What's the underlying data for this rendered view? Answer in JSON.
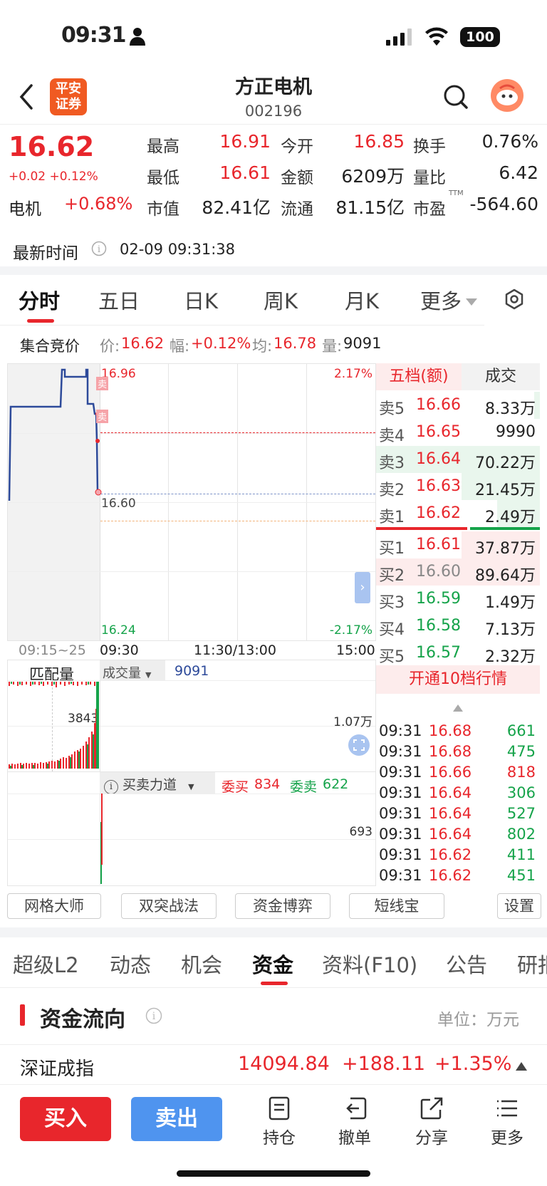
{
  "status": {
    "time": "09:31",
    "battery": "100"
  },
  "header": {
    "broker_logo": "平安\n证券",
    "broker_line1": "平安",
    "broker_line2": "证券",
    "title": "方正电机",
    "code": "002196"
  },
  "quote": {
    "price": "16.62",
    "change": "+0.02 +0.12%",
    "sector_label": "电机",
    "sector_change": "+0.68%",
    "fields": [
      {
        "label": "最高",
        "value": "16.91",
        "color": "red"
      },
      {
        "label": "今开",
        "value": "16.85",
        "color": "red"
      },
      {
        "label": "换手",
        "value": "0.76%",
        "color": "black"
      },
      {
        "label": "最低",
        "value": "16.61",
        "color": "red"
      },
      {
        "label": "金额",
        "value": "6209万",
        "color": "black"
      },
      {
        "label": "量比",
        "value": "6.42",
        "color": "black"
      },
      {
        "label": "市值",
        "value": "82.41亿",
        "color": "black"
      },
      {
        "label": "流通",
        "value": "81.15亿",
        "color": "black"
      },
      {
        "label": "市盈",
        "value": "-564.60",
        "color": "black",
        "sup": "TTM"
      }
    ],
    "latest_time_label": "最新时间",
    "latest_time": "02-09 09:31:38"
  },
  "chart_tabs": [
    "分时",
    "五日",
    "日K",
    "周K",
    "月K",
    "更多"
  ],
  "auction_bar": {
    "label": "集合竞价",
    "price_label": "价:",
    "price": "16.62",
    "range_label": "幅:",
    "range": "+0.12%",
    "avg_label": "均:",
    "avg": "16.78",
    "vol_label": "量:",
    "vol": "9091"
  },
  "chart": {
    "y_top": "16.96",
    "y_mid": "16.60",
    "y_bottom": "16.24",
    "pct_top": "2.17%",
    "pct_bottom": "-2.17%",
    "x_labels": [
      "09:15~25",
      "09:30",
      "11:30/13:00",
      "15:00"
    ],
    "sell_marker": "卖",
    "match_label": "匹配量",
    "volume_label": "成交量",
    "volume_value": "9091",
    "match_value": "3843",
    "volume_right": "1.07万",
    "force_label": "买卖力道",
    "bid_label": "委买",
    "bid_value": "834",
    "ask_label": "委卖",
    "ask_value": "622",
    "force_right": "693"
  },
  "orderbook": {
    "tab_active": "五档(额)",
    "tab_other": "成交",
    "asks": [
      {
        "label": "卖5",
        "price": "16.66",
        "amount": "8.33万"
      },
      {
        "label": "卖4",
        "price": "16.65",
        "amount": "9990"
      },
      {
        "label": "卖3",
        "price": "16.64",
        "amount": "70.22万"
      },
      {
        "label": "卖2",
        "price": "16.63",
        "amount": "21.45万"
      },
      {
        "label": "卖1",
        "price": "16.62",
        "amount": "2.49万"
      }
    ],
    "bids": [
      {
        "label": "买1",
        "price": "16.61",
        "amount": "37.87万"
      },
      {
        "label": "买2",
        "price": "16.60",
        "amount": "89.64万"
      },
      {
        "label": "买3",
        "price": "16.59",
        "amount": "1.49万"
      },
      {
        "label": "买4",
        "price": "16.58",
        "amount": "7.13万"
      },
      {
        "label": "买5",
        "price": "16.57",
        "amount": "2.32万"
      }
    ],
    "open_level10": "开通10档行情"
  },
  "ticks": [
    {
      "time": "09:31",
      "price": "16.68",
      "vol": "661"
    },
    {
      "time": "09:31",
      "price": "16.68",
      "vol": "475"
    },
    {
      "time": "09:31",
      "price": "16.66",
      "vol": "818"
    },
    {
      "time": "09:31",
      "price": "16.64",
      "vol": "306"
    },
    {
      "time": "09:31",
      "price": "16.64",
      "vol": "527"
    },
    {
      "time": "09:31",
      "price": "16.64",
      "vol": "802"
    },
    {
      "time": "09:31",
      "price": "16.62",
      "vol": "411"
    },
    {
      "time": "09:31",
      "price": "16.62",
      "vol": "451"
    }
  ],
  "tools": [
    "网格大师",
    "双突战法",
    "资金博弈",
    "短线宝",
    "设置"
  ],
  "sub_tabs": [
    "超级L2",
    "动态",
    "机会",
    "资金",
    "资料(F10)",
    "公告",
    "研报"
  ],
  "fund_flow": {
    "title": "资金流向",
    "unit": "单位：万元"
  },
  "index_row": {
    "name": "深证成指",
    "value": "14094.84",
    "change": "+188.11",
    "pct": "+1.35%"
  },
  "bottom": {
    "buy": "买入",
    "sell": "卖出",
    "items": [
      "持仓",
      "撤单",
      "分享",
      "更多"
    ]
  },
  "colors": {
    "red": "#e8262c",
    "green": "#15a34a",
    "buy_btn": "#e8262c",
    "sell_btn": "#4f94ef",
    "line": "#2d4a9a"
  }
}
